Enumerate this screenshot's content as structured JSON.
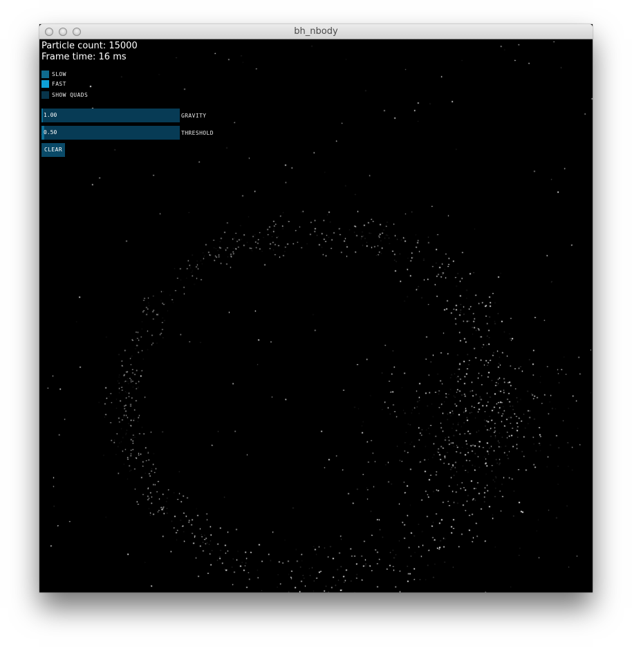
{
  "window": {
    "title": "bh_nbody"
  },
  "hud": {
    "particle_count": "Particle count: 15000",
    "frame_time": "Frame time: 16 ms"
  },
  "controls": {
    "toggles": [
      {
        "label": "SLOW",
        "active": false,
        "color": "#0f6a8d"
      },
      {
        "label": "FAST",
        "active": true,
        "color": "#0ea0d6"
      },
      {
        "label": "SHOW QUADS",
        "active": false,
        "color": "#08354b"
      }
    ],
    "sliders": [
      {
        "label": "GRAVITY",
        "value_text": "1.00",
        "fraction": 0.0
      },
      {
        "label": "THRESHOLD",
        "value_text": "0.50",
        "fraction": 0.02
      }
    ],
    "clear_button": "CLEAR"
  },
  "colors": {
    "background": "#000000",
    "particle": "#ffffff",
    "ui_track": "#073b55",
    "ui_button": "#0a4a68"
  }
}
